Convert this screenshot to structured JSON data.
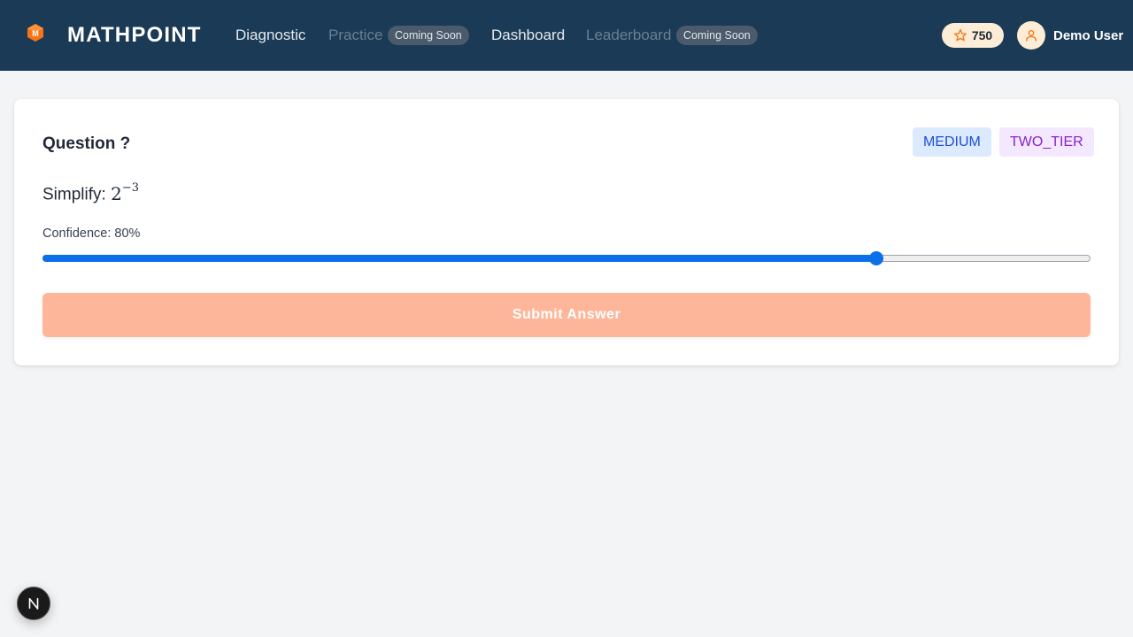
{
  "header": {
    "brand": "MATHPOINT",
    "logo_letter": "M",
    "nav": [
      {
        "label": "Diagnostic",
        "enabled": true
      },
      {
        "label": "Practice",
        "enabled": false,
        "badge": "Coming Soon"
      },
      {
        "label": "Dashboard",
        "enabled": true
      },
      {
        "label": "Leaderboard",
        "enabled": false,
        "badge": "Coming Soon"
      }
    ],
    "points": "750",
    "user_name": "Demo User"
  },
  "question": {
    "title": "Question ?",
    "difficulty": "MEDIUM",
    "type": "TWO_TIER",
    "prompt": "Simplify:",
    "math_base": "2",
    "math_exponent": "−3",
    "confidence_label": "Confidence: 80%",
    "confidence_value": 80,
    "submit_label": "Submit Answer"
  },
  "colors": {
    "header_bg": "#1b3a55",
    "accent": "#f97316",
    "submit_disabled": "#feb69a",
    "slider": "#0b6fe8"
  },
  "icons": {
    "logo": "hexagon-logo-icon",
    "points": "star-icon",
    "avatar": "user-icon",
    "dev_tool": "next-n-icon"
  }
}
